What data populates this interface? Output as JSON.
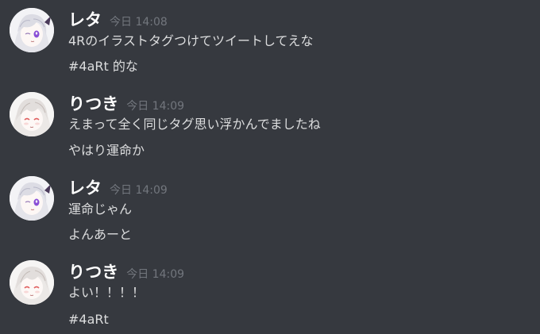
{
  "messages": [
    {
      "username": "レタ",
      "timestamp": "今日 14:08",
      "lines": [
        "4Rのイラストタグつけてツイートしてえな",
        "#4aRt 的な"
      ]
    },
    {
      "username": "りつき",
      "timestamp": "今日 14:09",
      "lines": [
        "えまって全く同じタグ思い浮かんでましたね",
        "やはり運命か"
      ]
    },
    {
      "username": "レタ",
      "timestamp": "今日 14:09",
      "lines": [
        "運命じゃん",
        "よんあーと"
      ]
    },
    {
      "username": "りつき",
      "timestamp": "今日 14:09",
      "lines": [
        "よい！！！！",
        "#4aRt"
      ]
    }
  ],
  "colors": {
    "background": "#36393f",
    "username": "#ffffff",
    "timestamp": "#72767d",
    "message_text": "#dcddde",
    "reta_eye_accent": "#8a4fd6",
    "ritsuki_eye_accent": "#e06060"
  },
  "icons": {
    "avatar_reta": "anime-avatar-white-hair-purple-eye",
    "avatar_ritsuki": "anime-avatar-white-hair-red-eye"
  }
}
